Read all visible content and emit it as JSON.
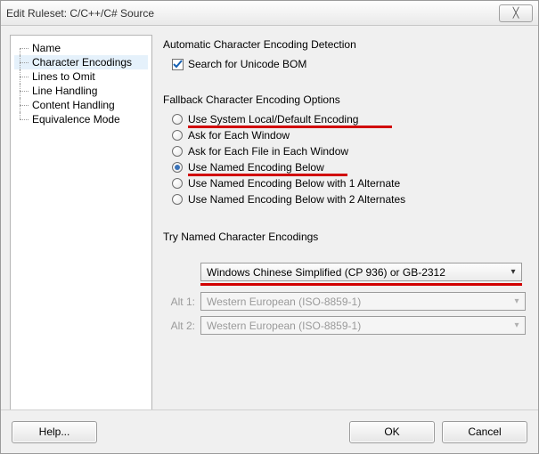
{
  "title": "Edit Ruleset: C/C++/C# Source",
  "sidebar": {
    "items": [
      {
        "label": "Name"
      },
      {
        "label": "Character Encodings"
      },
      {
        "label": "Lines to Omit"
      },
      {
        "label": "Line Handling"
      },
      {
        "label": "Content Handling"
      },
      {
        "label": "Equivalence Mode"
      }
    ],
    "selected_index": 1
  },
  "section_auto": {
    "heading": "Automatic Character Encoding Detection",
    "search_bom_label": "Search for Unicode BOM",
    "search_bom_checked": true
  },
  "section_fallback": {
    "heading": "Fallback Character Encoding Options",
    "options": [
      "Use System Local/Default Encoding",
      "Ask for Each Window",
      "Ask for Each File in Each Window",
      "Use Named Encoding Below",
      "Use Named Encoding Below with 1 Alternate",
      "Use Named Encoding Below with 2 Alternates"
    ],
    "selected_index": 3,
    "highlight_indices": [
      0,
      3
    ]
  },
  "section_named": {
    "heading": "Try Named Character Encodings",
    "primary": "Windows Chinese Simplified (CP 936) or GB-2312",
    "alt1_label": "Alt 1:",
    "alt1_value": "Western European (ISO-8859-1)",
    "alt2_label": "Alt 2:",
    "alt2_value": "Western European (ISO-8859-1)"
  },
  "footer": {
    "help": "Help...",
    "ok": "OK",
    "cancel": "Cancel"
  }
}
